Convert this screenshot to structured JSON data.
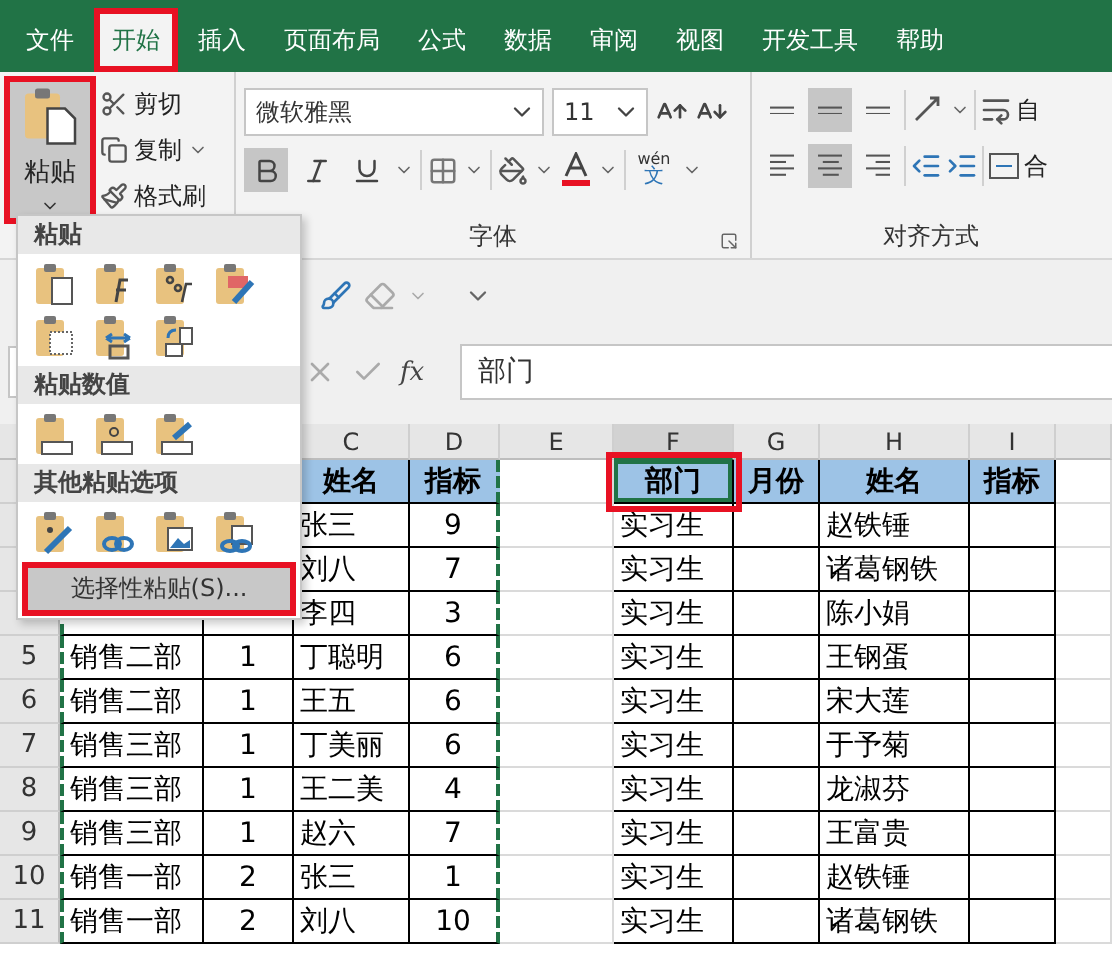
{
  "ribbon_tabs": [
    {
      "label": "文件",
      "selected": false,
      "highlighted": false
    },
    {
      "label": "开始",
      "selected": true,
      "highlighted": true
    },
    {
      "label": "插入",
      "selected": false,
      "highlighted": false
    },
    {
      "label": "页面布局",
      "selected": false,
      "highlighted": false
    },
    {
      "label": "公式",
      "selected": false,
      "highlighted": false
    },
    {
      "label": "数据",
      "selected": false,
      "highlighted": false
    },
    {
      "label": "审阅",
      "selected": false,
      "highlighted": false
    },
    {
      "label": "视图",
      "selected": false,
      "highlighted": false
    },
    {
      "label": "开发工具",
      "selected": false,
      "highlighted": false
    },
    {
      "label": "帮助",
      "selected": false,
      "highlighted": false
    }
  ],
  "clipboard": {
    "paste_label": "粘贴",
    "paste_highlighted": true,
    "actions": [
      {
        "kind": "cut",
        "label": "剪切"
      },
      {
        "kind": "copy",
        "label": "复制"
      },
      {
        "kind": "format-painter",
        "label": "格式刷"
      }
    ]
  },
  "font": {
    "name": "微软雅黑",
    "size": "11",
    "bold": true,
    "phonetic_top": "wén",
    "phonetic_char": "文",
    "group_label": "字体"
  },
  "alignment": {
    "vertical_buttons": [
      {
        "selected": false
      },
      {
        "selected": true
      },
      {
        "selected": false
      }
    ],
    "horizontal_buttons": [
      {
        "selected": false
      },
      {
        "selected": true
      },
      {
        "selected": false
      }
    ],
    "wrap_label": "自",
    "merge_label": "合",
    "group_label": "对齐方式"
  },
  "formula_bar": {
    "fx_label": "fx",
    "value": "部门"
  },
  "paste_menu": {
    "sections": [
      {
        "title": "粘贴",
        "icons": [
          {
            "kind": "paste"
          },
          {
            "kind": "formulas"
          },
          {
            "kind": "formulas-number"
          },
          {
            "kind": "keep-format"
          },
          {
            "kind": "no-borders"
          },
          {
            "kind": "keep-width"
          },
          {
            "kind": "transpose"
          }
        ]
      },
      {
        "title": "粘贴数值",
        "icons": [
          {
            "kind": "values"
          },
          {
            "kind": "values-number"
          },
          {
            "kind": "values-format"
          }
        ]
      },
      {
        "title": "其他粘贴选项",
        "icons": [
          {
            "kind": "formatting"
          },
          {
            "kind": "link"
          },
          {
            "kind": "picture"
          },
          {
            "kind": "linked-picture"
          }
        ]
      }
    ],
    "special_paste": {
      "label": "选择性粘贴(S)...",
      "highlighted": true
    }
  },
  "columns": [
    {
      "label": "C",
      "selected": false
    },
    {
      "label": "D",
      "selected": false
    },
    {
      "label": "E",
      "selected": false
    },
    {
      "label": "F",
      "selected": true
    },
    {
      "label": "G",
      "selected": false
    },
    {
      "label": "H",
      "selected": false
    },
    {
      "label": "I",
      "selected": false
    }
  ],
  "copy_marquee": true,
  "active_cell_highlighted": true,
  "header_row": {
    "cells": {
      "C": "姓名",
      "D": "指标",
      "F": "部门",
      "G": "月份",
      "H": "姓名",
      "I": "指标"
    }
  },
  "rows": [
    {
      "cells": {
        "C": "张三",
        "D": "9",
        "F": "实习生",
        "H": "赵铁锤"
      }
    },
    {
      "cells": {
        "C": "刘八",
        "D": "7",
        "F": "实习生",
        "H": "诸葛钢铁"
      }
    },
    {
      "cells": {
        "C": "李四",
        "D": "3",
        "F": "实习生",
        "H": "陈小娟"
      }
    },
    {
      "number": "5",
      "cells": {
        "A": "销售二部",
        "B": "1",
        "C": "丁聪明",
        "D": "6",
        "F": "实习生",
        "H": "王钢蛋"
      }
    },
    {
      "number": "6",
      "cells": {
        "A": "销售二部",
        "B": "1",
        "C": "王五",
        "D": "6",
        "F": "实习生",
        "H": "宋大莲"
      }
    },
    {
      "number": "7",
      "cells": {
        "A": "销售三部",
        "B": "1",
        "C": "丁美丽",
        "D": "6",
        "F": "实习生",
        "H": "于予菊"
      }
    },
    {
      "number": "8",
      "cells": {
        "A": "销售三部",
        "B": "1",
        "C": "王二美",
        "D": "4",
        "F": "实习生",
        "H": "龙淑芬"
      }
    },
    {
      "number": "9",
      "cells": {
        "A": "销售三部",
        "B": "1",
        "C": "赵六",
        "D": "7",
        "F": "实习生",
        "H": "王富贵"
      }
    },
    {
      "number": "10",
      "cells": {
        "A": "销售一部",
        "B": "2",
        "C": "张三",
        "D": "1",
        "F": "实习生",
        "H": "赵铁锤"
      }
    },
    {
      "number": "11",
      "cells": {
        "A": "销售一部",
        "B": "2",
        "C": "刘八",
        "D": "10",
        "F": "实习生",
        "H": "诸葛钢铁"
      }
    }
  ]
}
